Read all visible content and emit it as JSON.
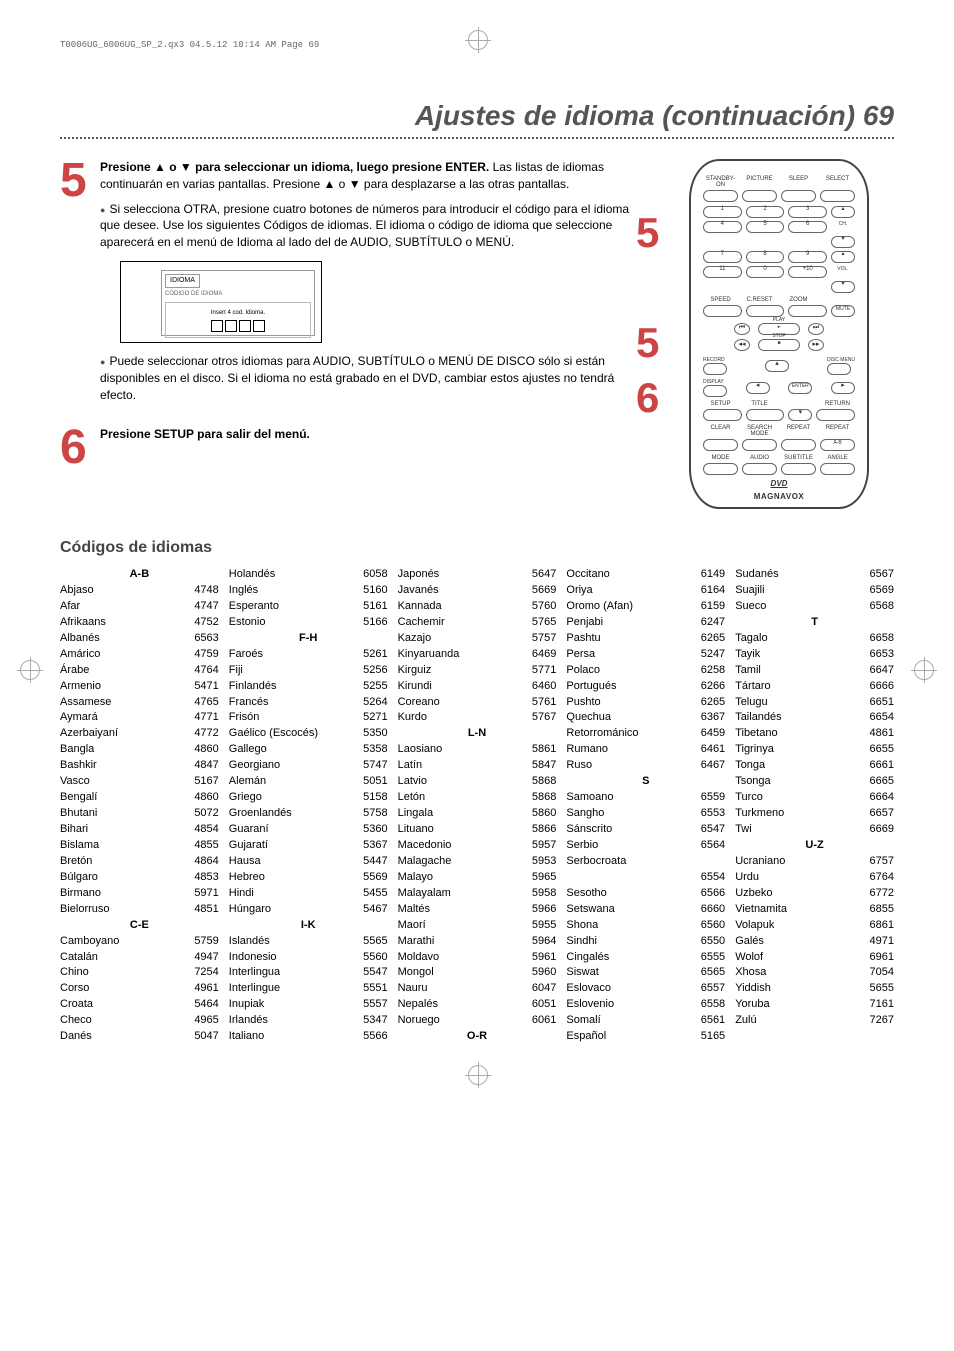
{
  "meta_header": "T0006UG_6006UG_SP_2.qx3  04.5.12  10:14 AM  Page 69",
  "page_title": "Ajustes de idioma (continuación)  69",
  "step5": {
    "line1_a": "Presione ",
    "line1_b": " o ",
    "line1_c": " para seleccionar un idioma, luego presione ENTER.",
    "line2": "  Las listas de idiomas continuarán en varias pantallas.  Presione ▲ o ▼ para desplazarse a las otras pantallas.",
    "bullet1": "Si selecciona OTRA, presione cuatro botones de números para introducir el código para el idioma que desee.  Use los siguientes Códigos de idiomas.  El idioma o código de idioma que seleccione aparecerá  en el menú de Idioma al lado del de AUDIO, SUBTÍTULO o MENÚ.",
    "bullet2": "Puede seleccionar otros idiomas para AUDIO, SUBTÍTULO o MENÚ DE DISCO sólo si están disponibles en el disco.  Si el idioma no está grabado en el DVD, cambiar estos ajustes no tendrá efecto."
  },
  "osd": {
    "idioma": "IDIOMA",
    "codigo": "CÓDIGO DE IDIOMA",
    "insert": "Insert 4 cod. Idioma."
  },
  "step6": {
    "text": "Presione SETUP para salir del menú."
  },
  "codes_section_title": "Códigos de idiomas",
  "remote": {
    "top_labels": [
      "STANDBY-ON",
      "PICTURE",
      "SLEEP",
      "SELECT"
    ],
    "numpad": [
      [
        "1",
        "2",
        "3"
      ],
      [
        "4",
        "5",
        "6"
      ],
      [
        "7",
        "8",
        "9"
      ],
      [
        "11",
        "0",
        "+10"
      ]
    ],
    "side_labels": {
      "ch": "CH.",
      "plus100": "+100",
      "vol": "VOL."
    },
    "row_labels1": [
      "SPEED",
      "C.RESET",
      "ZOOM"
    ],
    "mute": "MUTE",
    "transport": {
      "play": "PLAY",
      "stop": "STOP"
    },
    "record": "RECORD",
    "disc_menu": "DISC MENU",
    "display": "DISPLAY",
    "enter": "ENTER",
    "row_labels2": [
      "SETUP",
      "TITLE",
      "",
      "RETURN"
    ],
    "row_labels3": [
      "CLEAR",
      "SEARCH MODE",
      "REPEAT",
      "REPEAT"
    ],
    "ab": "A-B",
    "row_labels4": [
      "MODE",
      "AUDIO",
      "SUBTITLE",
      "ANGLE"
    ],
    "dvd": "DVD",
    "brand": "MAGNAVOX"
  },
  "codes": {
    "groups": [
      {
        "head": "A-B",
        "items": [
          [
            "Abjaso",
            "4748"
          ],
          [
            "Afar",
            "4747"
          ],
          [
            "Afrikaans",
            "4752"
          ],
          [
            "Albanés",
            "6563"
          ],
          [
            "Amárico",
            "4759"
          ],
          [
            "Árabe",
            "4764"
          ],
          [
            "Armenio",
            "5471"
          ],
          [
            "Assamese",
            "4765"
          ],
          [
            "Aymará",
            "4771"
          ],
          [
            "Azerbaiyaní",
            "4772"
          ],
          [
            "Bangla",
            "4860"
          ],
          [
            "Bashkir",
            "4847"
          ],
          [
            "Vasco",
            "5167"
          ],
          [
            "Bengalí",
            "4860"
          ],
          [
            "Bhutani",
            "5072"
          ],
          [
            "Bihari",
            "4854"
          ],
          [
            "Bislama",
            "4855"
          ],
          [
            "Bretón",
            "4864"
          ],
          [
            "Búlgaro",
            "4853"
          ],
          [
            "Birmano",
            "5971"
          ],
          [
            "Bielorruso",
            "4851"
          ]
        ]
      },
      {
        "head": "C-E",
        "items": [
          [
            "Camboyano",
            "5759"
          ],
          [
            "Catalán",
            "4947"
          ],
          [
            "Chino",
            "7254"
          ],
          [
            "Corso",
            "4961"
          ],
          [
            "Croata",
            "5464"
          ],
          [
            "Checo",
            "4965"
          ],
          [
            "Danés",
            "5047"
          ],
          [
            "Holandés",
            "6058"
          ],
          [
            "Inglés",
            "5160"
          ],
          [
            "Esperanto",
            "5161"
          ],
          [
            "Estonio",
            "5166"
          ]
        ]
      },
      {
        "head": "F-H",
        "items": [
          [
            "Faroés",
            "5261"
          ],
          [
            "Fiji",
            "5256"
          ],
          [
            "Finlandés",
            "5255"
          ],
          [
            "Francés",
            "5264"
          ],
          [
            "Frisón",
            "5271"
          ],
          [
            "Gaélico (Escocés)",
            "5350"
          ],
          [
            "Gallego",
            "5358"
          ],
          [
            "Georgiano",
            "5747"
          ],
          [
            "Alemán",
            "5051"
          ],
          [
            "Griego",
            "5158"
          ],
          [
            "Groenlandés",
            "5758"
          ],
          [
            "Guaraní",
            "5360"
          ],
          [
            "Gujaratí",
            "5367"
          ],
          [
            "Hausa",
            "5447"
          ],
          [
            "Hebreo",
            "5569"
          ],
          [
            "Hindi",
            "5455"
          ],
          [
            "Húngaro",
            "5467"
          ]
        ]
      },
      {
        "head": "I-K",
        "items": [
          [
            "Islandés",
            "5565"
          ],
          [
            "Indonesio",
            "5560"
          ],
          [
            "Interlingua",
            "5547"
          ],
          [
            "Interlingue",
            "5551"
          ],
          [
            "Inupiak",
            "5557"
          ],
          [
            "Irlandés",
            "5347"
          ],
          [
            "Italiano",
            "5566"
          ],
          [
            "Japonés",
            "5647"
          ],
          [
            "Javanés",
            "5669"
          ],
          [
            "Kannada",
            "5760"
          ],
          [
            "Cachemir",
            "5765"
          ],
          [
            "Kazajo",
            "5757"
          ],
          [
            "Kinyaruanda",
            "6469"
          ],
          [
            "Kirguiz",
            "5771"
          ],
          [
            "Kirundi",
            "6460"
          ],
          [
            "Coreano",
            "5761"
          ],
          [
            "Kurdo",
            "5767"
          ]
        ]
      },
      {
        "head": "L-N",
        "items": [
          [
            "Laosiano",
            "5861"
          ],
          [
            "Latín",
            "5847"
          ],
          [
            "Latvio",
            "5868"
          ],
          [
            "Letón",
            "5868"
          ],
          [
            "Lingala",
            "5860"
          ],
          [
            "Lituano",
            "5866"
          ],
          [
            "Macedonio",
            "5957"
          ],
          [
            "Malagache",
            "5953"
          ],
          [
            "Malayo",
            "5965"
          ],
          [
            "Malayalam",
            "5958"
          ],
          [
            "Maltés",
            "5966"
          ],
          [
            "Maorí",
            "5955"
          ],
          [
            "Marathi",
            "5964"
          ],
          [
            "Moldavo",
            "5961"
          ],
          [
            "Mongol",
            "5960"
          ],
          [
            "Nauru",
            "6047"
          ],
          [
            "Nepalés",
            "6051"
          ],
          [
            "Noruego",
            "6061"
          ]
        ]
      },
      {
        "head": "O-R",
        "items": [
          [
            "Occitano",
            "6149"
          ],
          [
            "Oriya",
            "6164"
          ],
          [
            "Oromo (Afan)",
            "6159"
          ],
          [
            "Penjabi",
            "6247"
          ],
          [
            "Pashtu",
            "6265"
          ],
          [
            "Persa",
            "5247"
          ],
          [
            "Polaco",
            "6258"
          ],
          [
            "Portugués",
            "6266"
          ],
          [
            "Pushto",
            "6265"
          ],
          [
            "Quechua",
            "6367"
          ],
          [
            "Retorrománico",
            "6459"
          ],
          [
            "Rumano",
            "6461"
          ],
          [
            "Ruso",
            "6467"
          ]
        ]
      },
      {
        "head": "S",
        "items": [
          [
            "Samoano",
            "6559"
          ],
          [
            "Sangho",
            "6553"
          ],
          [
            "Sánscrito",
            "6547"
          ],
          [
            "Serbio",
            "6564"
          ],
          [
            "Serbocroata",
            ""
          ],
          [
            "",
            "6554"
          ],
          [
            "Sesotho",
            "6566"
          ],
          [
            "Setswana",
            "6660"
          ],
          [
            "Shona",
            "6560"
          ],
          [
            "Sindhi",
            "6550"
          ],
          [
            "Cingalés",
            "6555"
          ],
          [
            "Siswat",
            "6565"
          ],
          [
            "Eslovaco",
            "6557"
          ],
          [
            "Eslovenio",
            "6558"
          ],
          [
            "Somalí",
            "6561"
          ],
          [
            "Español",
            "5165"
          ],
          [
            "Sudanés",
            "6567"
          ],
          [
            "Suajili",
            "6569"
          ],
          [
            "Sueco",
            "6568"
          ]
        ]
      },
      {
        "head": "T",
        "items": [
          [
            "Tagalo",
            "6658"
          ],
          [
            "Tayik",
            "6653"
          ],
          [
            "Tamil",
            "6647"
          ],
          [
            "Tártaro",
            "6666"
          ],
          [
            "Telugu",
            "6651"
          ],
          [
            "Tailandés",
            "6654"
          ],
          [
            "Tibetano",
            "4861"
          ],
          [
            "Tigrinya",
            "6655"
          ],
          [
            "Tonga",
            "6661"
          ],
          [
            "Tsonga",
            "6665"
          ],
          [
            "Turco",
            "6664"
          ],
          [
            "Turkmeno",
            "6657"
          ],
          [
            "Twi",
            "6669"
          ]
        ]
      },
      {
        "head": "U-Z",
        "items": [
          [
            "Ucraniano",
            "6757"
          ],
          [
            "Urdu",
            "6764"
          ],
          [
            "Uzbeko",
            "6772"
          ],
          [
            "Vietnamita",
            "6855"
          ],
          [
            "Volapuk",
            "6861"
          ],
          [
            "Galés",
            "4971"
          ],
          [
            "Wolof",
            "6961"
          ],
          [
            "Xhosa",
            "7054"
          ],
          [
            "Yiddish",
            "5655"
          ],
          [
            "Yoruba",
            "7161"
          ],
          [
            "Zulú",
            "7267"
          ]
        ]
      }
    ]
  }
}
